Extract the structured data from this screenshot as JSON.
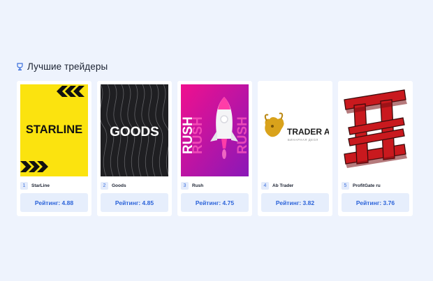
{
  "section": {
    "title": "Лучшие трейдеры",
    "icon": "trophy-icon"
  },
  "traders": [
    {
      "rank": "1",
      "name": "StarLine",
      "rating_label": "Рейтинг: 4.88",
      "logo_text": "STARLINE",
      "bg": "#fbe30f"
    },
    {
      "rank": "2",
      "name": "Goods",
      "rating_label": "Рейтинг: 4.85",
      "logo_text": "GOODS",
      "bg": "#1f1f22"
    },
    {
      "rank": "3",
      "name": "Rush",
      "rating_label": "Рейтинг: 4.75",
      "logo_text": "RUSH",
      "bg": "#e0129a"
    },
    {
      "rank": "4",
      "name": "Ab Trader",
      "rating_label": "Рейтинг: 3.82",
      "logo_text": "TRADER AE",
      "logo_subtext": "БИНАРНАЯ ДЕОЛ",
      "bg": "#ffffff"
    },
    {
      "rank": "5",
      "name": "ProfitGate ru",
      "rating_label": "Рейтинг: 3.76",
      "bg": "#ffffff"
    }
  ],
  "colors": {
    "accent": "#2b63d9",
    "page_bg": "#eef3fd",
    "button_bg": "#e6eefc"
  }
}
